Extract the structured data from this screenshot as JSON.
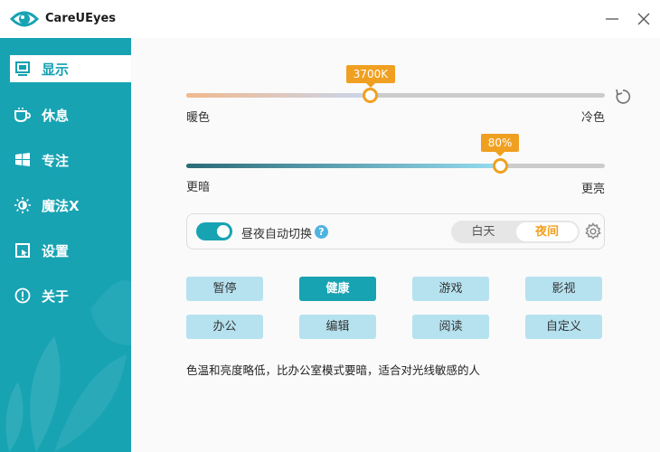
{
  "window": {
    "title": "CareUEyes"
  },
  "sidebar": {
    "items": [
      {
        "label": "显示",
        "icon": "monitor-icon",
        "active": true
      },
      {
        "label": "休息",
        "icon": "coffee-cup-icon",
        "active": false
      },
      {
        "label": "专注",
        "icon": "windows-icon",
        "active": false
      },
      {
        "label": "魔法X",
        "icon": "sun-moon-icon",
        "active": false
      },
      {
        "label": "设置",
        "icon": "settings-window-icon",
        "active": false
      },
      {
        "label": "关于",
        "icon": "info-icon",
        "active": false
      }
    ]
  },
  "temperature": {
    "value_label": "3700K",
    "level": 0.44,
    "left_label": "暖色",
    "right_label": "冷色"
  },
  "brightness": {
    "value_label": "80%",
    "level": 0.75,
    "left_label": "更暗",
    "right_label": "更亮"
  },
  "auto_switch": {
    "label": "昼夜自动切换",
    "help": "?",
    "enabled": true,
    "day_label": "白天",
    "night_label": "夜间",
    "selected": "夜间"
  },
  "modes": [
    {
      "label": "暂停",
      "active": false
    },
    {
      "label": "健康",
      "active": true
    },
    {
      "label": "游戏",
      "active": false
    },
    {
      "label": "影视",
      "active": false
    },
    {
      "label": "办公",
      "active": false
    },
    {
      "label": "编辑",
      "active": false
    },
    {
      "label": "阅读",
      "active": false
    },
    {
      "label": "自定义",
      "active": false
    }
  ],
  "description": "色温和亮度略低，比办公室模式要暗，适合对光线敏感的人",
  "colors": {
    "accent": "#18a3b3",
    "highlight": "#f0a020",
    "mode_button": "#b6e2f0"
  }
}
